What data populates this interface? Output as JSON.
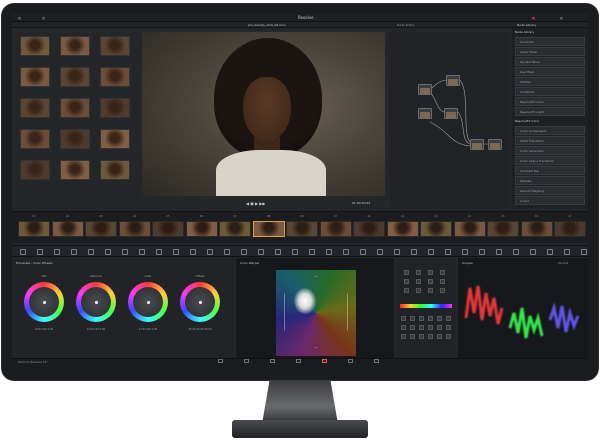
{
  "app": {
    "title": "Resolve",
    "project": "Resolve Studio 18"
  },
  "viewer": {
    "clip_name": "pro_beauty_shot_04.mov",
    "mode": "Node Editor",
    "timecode": "01:00:20:22"
  },
  "library": {
    "title": "Node Library",
    "items": [
      "Corrector",
      "Layer Mixer",
      "Parallel Mixer",
      "Key Mixer",
      "Splitter",
      "Combiner",
      "ResolveFX Color",
      "ResolveFX Light"
    ],
    "section2": "ResolveFX Color",
    "items2": [
      "Color Compressor",
      "ACES Transform",
      "Color Generator",
      "Color Space Transform",
      "Contrast Pop",
      "Dehaze",
      "Gamut Mapping",
      "Invert"
    ]
  },
  "wheels": {
    "title": "Primaries - Color Wheels",
    "labels": [
      "Lift",
      "Gamma",
      "Gain",
      "Offset"
    ],
    "values": [
      "0.00  0.00  0.00",
      "0.00  0.00  0.00",
      "1.00  1.00  1.00",
      "25.00 25.00 25.00"
    ]
  },
  "scope": {
    "left_title": "Color Warper",
    "right_title": "Scopes",
    "mode": "Parade"
  },
  "timeline": {
    "clips": [
      "01",
      "02",
      "03",
      "04",
      "05",
      "06",
      "07",
      "08",
      "09",
      "10",
      "11",
      "12",
      "13",
      "14",
      "15",
      "16",
      "17"
    ]
  },
  "status": {
    "label": "DaVinci Resolve 18"
  },
  "colors": {
    "accent": "#e05a5a",
    "bg": "#25262a"
  }
}
